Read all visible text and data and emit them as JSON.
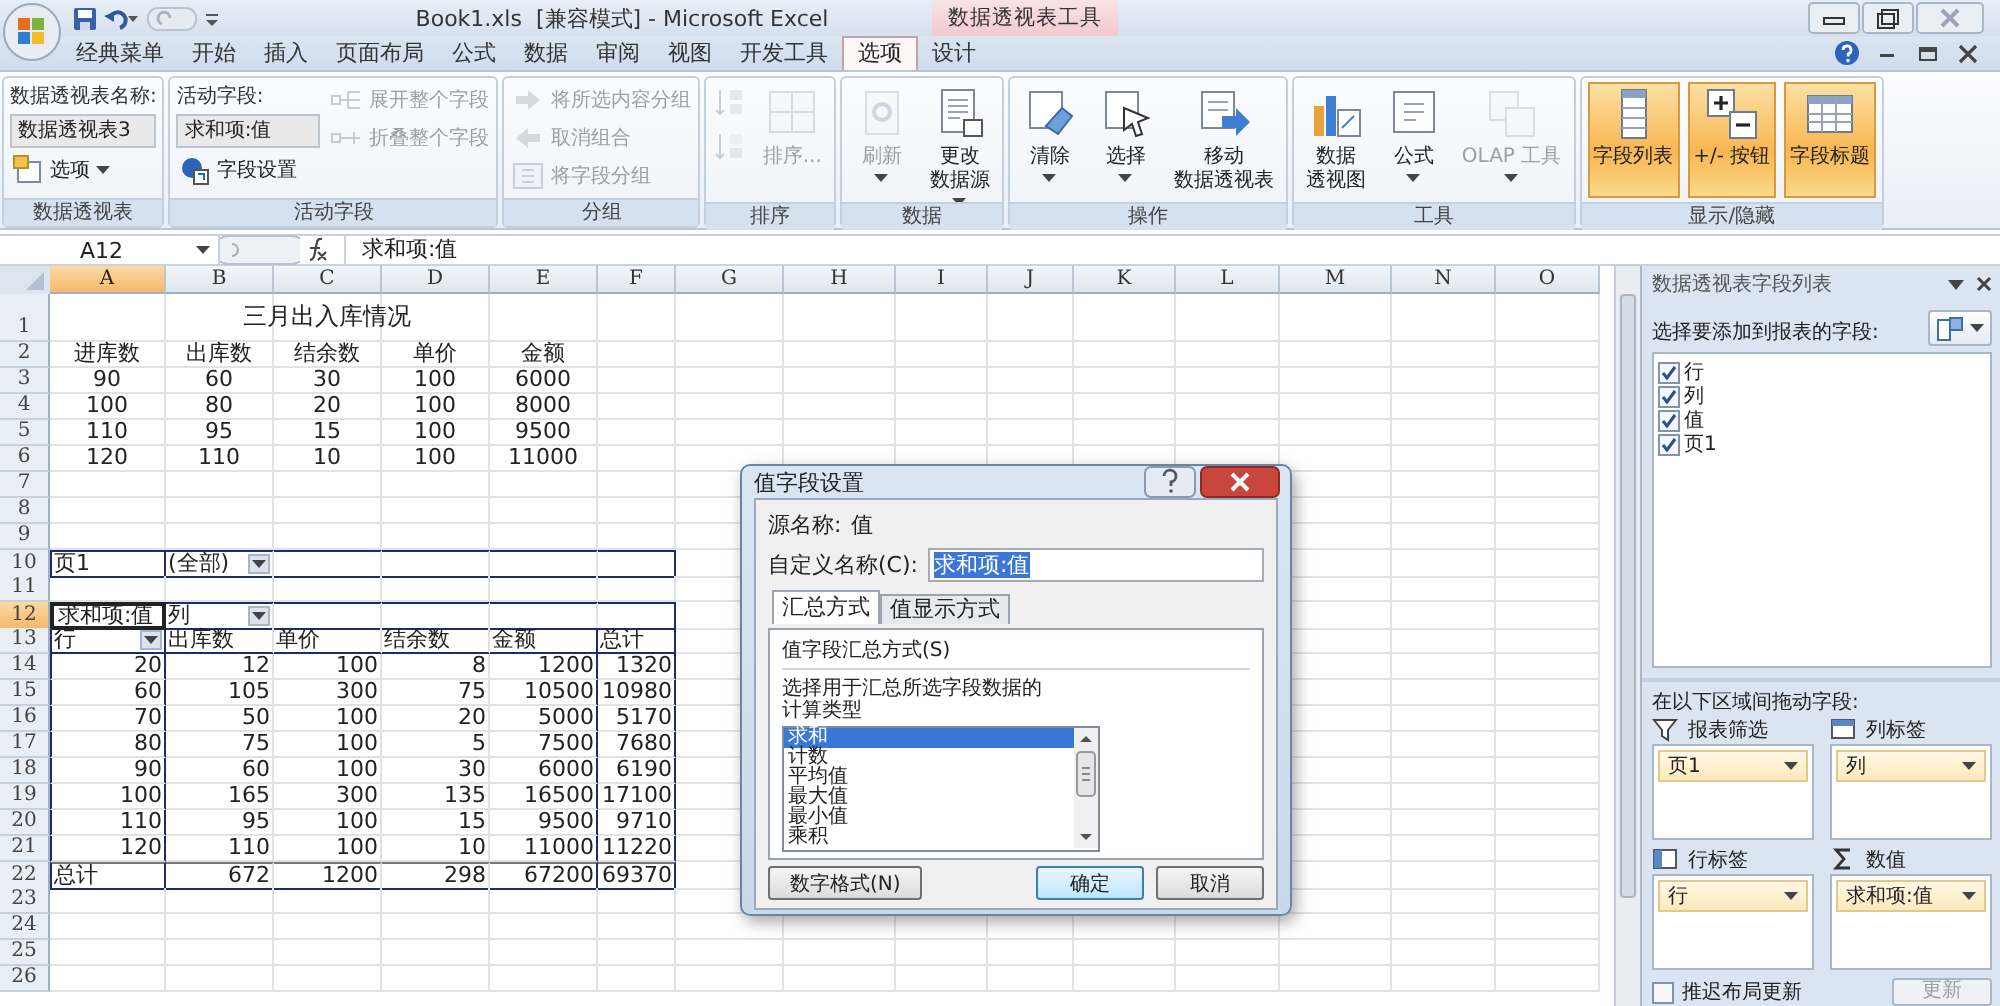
{
  "window": {
    "title": "Book1.xls  [兼容模式] - Microsoft Excel",
    "context_title": "数据透视表工具"
  },
  "tabs": [
    {
      "label": "经典菜单",
      "selected": false
    },
    {
      "label": "开始",
      "selected": false
    },
    {
      "label": "插入",
      "selected": false
    },
    {
      "label": "页面布局",
      "selected": false
    },
    {
      "label": "公式",
      "selected": false
    },
    {
      "label": "数据",
      "selected": false
    },
    {
      "label": "审阅",
      "selected": false
    },
    {
      "label": "视图",
      "selected": false
    },
    {
      "label": "开发工具",
      "selected": false
    },
    {
      "label": "选项",
      "selected": true
    },
    {
      "label": "设计",
      "selected": false
    }
  ],
  "ribbon": {
    "groups": [
      {
        "title": "数据透视表",
        "columns": [
          [
            {
              "kind": "label",
              "text": "数据透视表名称:"
            },
            {
              "kind": "field",
              "value": "数据透视表3"
            },
            {
              "kind": "small",
              "label": "选项",
              "dropdown": true,
              "disabled": false
            }
          ]
        ]
      },
      {
        "title": "活动字段",
        "columns": [
          [
            {
              "kind": "label",
              "text": "活动字段:"
            },
            {
              "kind": "field",
              "value": "求和项:值"
            },
            {
              "kind": "small",
              "label": "字段设置",
              "disabled": false
            }
          ],
          [
            {
              "kind": "small",
              "label": "展开整个字段",
              "disabled": true
            },
            {
              "kind": "small",
              "label": "折叠整个字段",
              "disabled": true
            }
          ]
        ]
      },
      {
        "title": "分组",
        "columns": [
          [
            {
              "kind": "small",
              "label": "将所选内容分组",
              "disabled": true
            },
            {
              "kind": "small",
              "label": "取消组合",
              "disabled": true
            },
            {
              "kind": "small",
              "label": "将字段分组",
              "disabled": true
            }
          ]
        ]
      },
      {
        "title": "排序",
        "columns": [
          [
            {
              "kind": "icon",
              "disabled": true
            },
            {
              "kind": "icon",
              "disabled": true
            }
          ],
          [
            {
              "kind": "large",
              "label": "排序...",
              "disabled": true
            }
          ]
        ]
      },
      {
        "title": "数据",
        "columns": [
          [
            {
              "kind": "large",
              "label": "刷新",
              "dropdown": true,
              "disabled": true
            }
          ],
          [
            {
              "kind": "large",
              "label": [
                "更改",
                "数据源"
              ],
              "dropdown": true,
              "disabled": false
            }
          ]
        ]
      },
      {
        "title": "操作",
        "columns": [
          [
            {
              "kind": "large",
              "label": "清除",
              "dropdown": true,
              "disabled": false
            }
          ],
          [
            {
              "kind": "large",
              "label": "选择",
              "dropdown": true,
              "disabled": false
            }
          ],
          [
            {
              "kind": "large",
              "label": [
                "移动",
                "数据透视表"
              ],
              "disabled": false
            }
          ]
        ]
      },
      {
        "title": "工具",
        "columns": [
          [
            {
              "kind": "large",
              "label": [
                "数据",
                "透视图"
              ],
              "disabled": false
            }
          ],
          [
            {
              "kind": "large",
              "label": "公式",
              "dropdown": true,
              "disabled": false
            }
          ],
          [
            {
              "kind": "large",
              "label": "OLAP 工具",
              "dropdown": true,
              "disabled": true
            }
          ]
        ]
      },
      {
        "title": "显示/隐藏",
        "columns": [
          [
            {
              "kind": "large",
              "label": "字段列表",
              "on": true,
              "disabled": false
            }
          ],
          [
            {
              "kind": "large",
              "label": "+/- 按钮",
              "on": true,
              "disabled": false
            }
          ],
          [
            {
              "kind": "large",
              "label": "字段标题",
              "on": true,
              "disabled": false
            }
          ]
        ]
      }
    ]
  },
  "formula_bar": {
    "name_box": "A12",
    "formula": "求和项:值"
  },
  "sheet": {
    "columns": [
      {
        "label": "A",
        "selected": true
      },
      {
        "label": "B",
        "selected": false
      },
      {
        "label": "C",
        "selected": false
      },
      {
        "label": "D",
        "selected": false
      },
      {
        "label": "E",
        "selected": false
      },
      {
        "label": "F",
        "selected": false
      },
      {
        "label": "G",
        "selected": false
      },
      {
        "label": "H",
        "selected": false
      },
      {
        "label": "I",
        "selected": false
      },
      {
        "label": "J",
        "selected": false
      },
      {
        "label": "K",
        "selected": false
      },
      {
        "label": "L",
        "selected": false
      },
      {
        "label": "M",
        "selected": false
      },
      {
        "label": "N",
        "selected": false
      },
      {
        "label": "O",
        "selected": false
      }
    ],
    "rows": [
      {
        "number": "1",
        "selected": false,
        "kind": "title",
        "cells": [
          "",
          "",
          "三月出入库情况"
        ]
      },
      {
        "number": "2",
        "selected": false,
        "kind": "table",
        "cells": [
          "进库数",
          "出库数",
          "结余数",
          "单价",
          "金额"
        ]
      },
      {
        "number": "3",
        "selected": false,
        "kind": "table",
        "cells": [
          "90",
          "60",
          "30",
          "100",
          "6000"
        ]
      },
      {
        "number": "4",
        "selected": false,
        "kind": "table",
        "cells": [
          "100",
          "80",
          "20",
          "100",
          "8000"
        ]
      },
      {
        "number": "5",
        "selected": false,
        "kind": "table",
        "cells": [
          "110",
          "95",
          "15",
          "100",
          "9500"
        ]
      },
      {
        "number": "6",
        "selected": false,
        "kind": "table",
        "cells": [
          "120",
          "110",
          "10",
          "100",
          "11000"
        ]
      },
      {
        "number": "7",
        "selected": false,
        "kind": "empty",
        "cells": []
      },
      {
        "number": "8",
        "selected": false,
        "kind": "empty",
        "cells": []
      },
      {
        "number": "9",
        "selected": false,
        "kind": "empty",
        "cells": []
      },
      {
        "number": "10",
        "selected": false,
        "kind": "pivot-filter",
        "cells": [
          "页1",
          {
            "text": "(全部)",
            "dropdown": true
          }
        ]
      },
      {
        "number": "11",
        "selected": false,
        "kind": "empty",
        "cells": []
      },
      {
        "number": "12",
        "selected": true,
        "kind": "pivot-corner",
        "cells": [
          {
            "text": "求和项:值",
            "selected": true
          },
          {
            "text": "列",
            "dropdown": true
          }
        ]
      },
      {
        "number": "13",
        "selected": false,
        "kind": "pivot-header",
        "cells": [
          {
            "text": "行",
            "dropdown": true
          },
          "出库数",
          "单价",
          "结余数",
          "金额",
          "总计"
        ]
      },
      {
        "number": "14",
        "selected": false,
        "kind": "pivot-body",
        "cells": [
          "20",
          "12",
          "100",
          "8",
          "1200",
          "1320"
        ]
      },
      {
        "number": "15",
        "selected": false,
        "kind": "pivot-body",
        "cells": [
          "60",
          "105",
          "300",
          "75",
          "10500",
          "10980"
        ]
      },
      {
        "number": "16",
        "selected": false,
        "kind": "pivot-body",
        "cells": [
          "70",
          "50",
          "100",
          "20",
          "5000",
          "5170"
        ]
      },
      {
        "number": "17",
        "selected": false,
        "kind": "pivot-body",
        "cells": [
          "80",
          "75",
          "100",
          "5",
          "7500",
          "7680"
        ]
      },
      {
        "number": "18",
        "selected": false,
        "kind": "pivot-body",
        "cells": [
          "90",
          "60",
          "100",
          "30",
          "6000",
          "6190"
        ]
      },
      {
        "number": "19",
        "selected": false,
        "kind": "pivot-body",
        "cells": [
          "100",
          "165",
          "300",
          "135",
          "16500",
          "17100"
        ]
      },
      {
        "number": "20",
        "selected": false,
        "kind": "pivot-body",
        "cells": [
          "110",
          "95",
          "100",
          "15",
          "9500",
          "9710"
        ]
      },
      {
        "number": "21",
        "selected": false,
        "kind": "pivot-body",
        "cells": [
          "120",
          "110",
          "100",
          "10",
          "11000",
          "11220"
        ]
      },
      {
        "number": "22",
        "selected": false,
        "kind": "pivot-total",
        "cells": [
          "总计",
          "672",
          "1200",
          "298",
          "67200",
          "69370"
        ]
      },
      {
        "number": "23",
        "selected": false,
        "kind": "empty",
        "cells": []
      },
      {
        "number": "24",
        "selected": false,
        "kind": "empty",
        "cells": []
      },
      {
        "number": "25",
        "selected": false,
        "kind": "empty",
        "cells": []
      },
      {
        "number": "26",
        "selected": false,
        "kind": "empty",
        "cells": []
      }
    ]
  },
  "dialog": {
    "title": "值字段设置",
    "source_label": "源名称:",
    "source_value": "值",
    "custom_label": "自定义名称(C):",
    "custom_value": "求和项:值",
    "tabs": [
      {
        "label": "汇总方式",
        "selected": true
      },
      {
        "label": "值显示方式",
        "selected": false
      }
    ],
    "section": "值字段汇总方式(S)",
    "description": "选择用于汇总所选字段数据的计算类型",
    "options": [
      {
        "label": "求和",
        "selected": true
      },
      {
        "label": "计数",
        "selected": false
      },
      {
        "label": "平均值",
        "selected": false
      },
      {
        "label": "最大值",
        "selected": false
      },
      {
        "label": "最小值",
        "selected": false
      },
      {
        "label": "乘积",
        "selected": false
      }
    ],
    "buttons": [
      {
        "label": "数字格式(N)",
        "default": false
      },
      {
        "label": "确定",
        "default": true
      },
      {
        "label": "取消",
        "default": false
      }
    ]
  },
  "field_list": {
    "title": "数据透视表字段列表",
    "prompt": "选择要添加到报表的字段:",
    "fields": [
      {
        "label": "行",
        "checked": true
      },
      {
        "label": "列",
        "checked": true
      },
      {
        "label": "值",
        "checked": true
      },
      {
        "label": "页1",
        "checked": true
      }
    ],
    "drag_prompt": "在以下区域间拖动字段:",
    "areas": [
      {
        "title": "报表筛选",
        "fields": [
          "页1"
        ]
      },
      {
        "title": "列标签",
        "fields": [
          "列"
        ]
      },
      {
        "title": "行标签",
        "fields": [
          "行"
        ]
      },
      {
        "title": "数值",
        "fields": [
          "求和项:值"
        ]
      }
    ],
    "defer": {
      "label": "推迟布局更新",
      "checked": false
    },
    "update_button": {
      "label": "更新",
      "disabled": true
    }
  }
}
